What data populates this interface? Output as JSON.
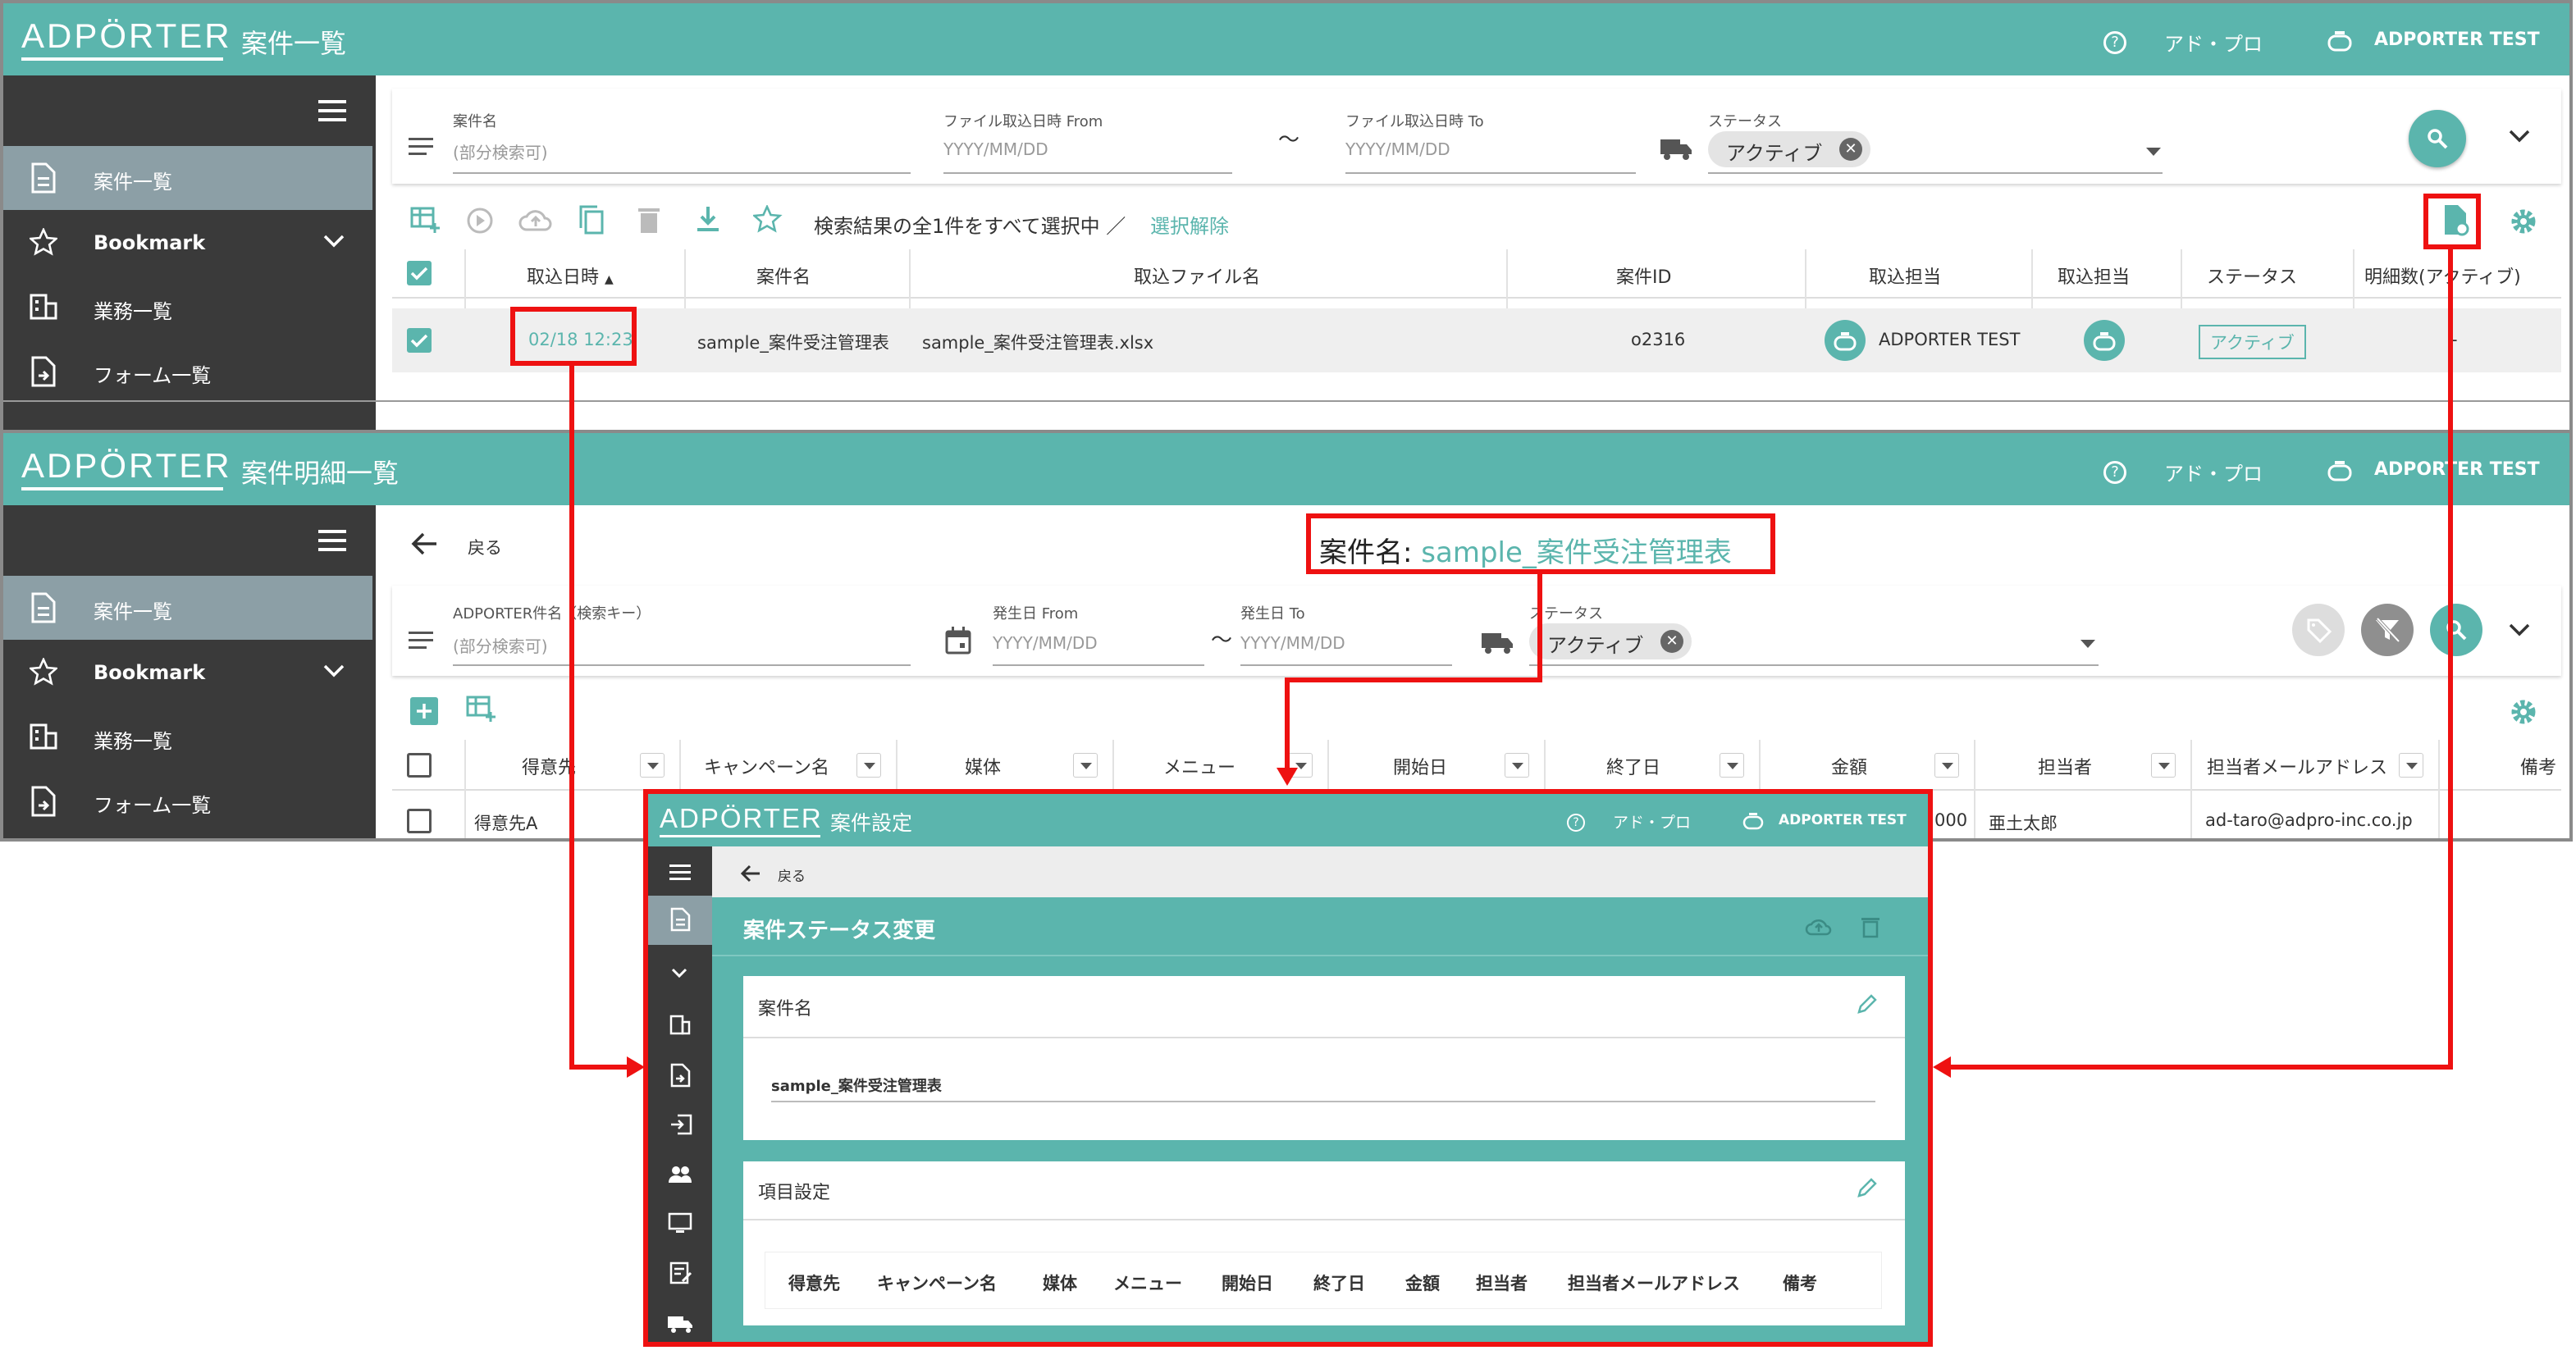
{
  "brand": {
    "logo": "ADPÖRTER"
  },
  "panel1": {
    "title": "案件一覧",
    "header": {
      "help_label": "アド・プロ",
      "user_label": "ADPORTER TEST"
    },
    "sidebar": {
      "items": [
        {
          "label": "案件一覧",
          "icon": "document-icon",
          "active": true
        },
        {
          "label": "Bookmark",
          "icon": "star-icon"
        },
        {
          "label": "業務一覧",
          "icon": "building-icon"
        },
        {
          "label": "フォーム一覧",
          "icon": "form-icon"
        }
      ]
    },
    "filters": {
      "case_name_label": "案件名",
      "case_name_placeholder": "(部分検索可)",
      "file_from_label": "ファイル取込日時 From",
      "file_from_placeholder": "YYYY/MM/DD",
      "tilde": "〜",
      "file_to_label": "ファイル取込日時 To",
      "file_to_placeholder": "YYYY/MM/DD",
      "status_label": "ステータス",
      "status_chip": "アクティブ"
    },
    "toolbar": {
      "selection_text": "検索結果の全1件をすべて選択中 ／",
      "deselect_link": "選択解除"
    },
    "table": {
      "columns": [
        "取込日時",
        "案件名",
        "取込ファイル名",
        "案件ID",
        "取込担当",
        "取込担当",
        "ステータス",
        "明細数(アクティブ)"
      ],
      "sort_indicator": "▲",
      "rows": [
        {
          "date": "02/18 12:23",
          "case_name": "sample_案件受注管理表",
          "file": "sample_案件受注管理表.xlsx",
          "case_id": "o2316",
          "owner": "ADPORTER TEST",
          "status": "アクティブ",
          "count": "-"
        }
      ]
    }
  },
  "panel2": {
    "title": "案件明細一覧",
    "header": {
      "help_label": "アド・プロ",
      "user_label": "ADPORTER TEST"
    },
    "back_label": "戻る",
    "case_name_prefix": "案件名:",
    "case_name_value": "sample_案件受注管理表",
    "sidebar": {
      "items": [
        {
          "label": "案件一覧",
          "icon": "document-icon",
          "active": true
        },
        {
          "label": "Bookmark",
          "icon": "star-icon"
        },
        {
          "label": "業務一覧",
          "icon": "building-icon"
        },
        {
          "label": "フォーム一覧",
          "icon": "form-icon"
        }
      ]
    },
    "filters": {
      "key_label": "ADPORTER件名（検索キー）",
      "key_placeholder": "(部分検索可)",
      "from_label": "発生日 From",
      "from_placeholder": "YYYY/MM/DD",
      "tilde": "〜",
      "to_label": "発生日 To",
      "to_placeholder": "YYYY/MM/DD",
      "status_label": "ステータス",
      "status_chip": "アクティブ"
    },
    "table": {
      "columns": [
        "得意先",
        "キャンペーン名",
        "媒体",
        "メニュー",
        "開始日",
        "終了日",
        "金額",
        "担当者",
        "担当者メールアドレス",
        "備考"
      ],
      "rows": [
        {
          "client": "得意先A",
          "amount_tail": "000",
          "person": "亜土太郎",
          "email": "ad-taro@adpro-inc.co.jp"
        }
      ]
    }
  },
  "panel3": {
    "title": "案件設定",
    "header": {
      "help_label": "アド・プロ",
      "user_label": "ADPORTER TEST"
    },
    "back_label": "戻る",
    "section_title": "案件ステータス変更",
    "case_name_card": {
      "title": "案件名",
      "value": "sample_案件受注管理表"
    },
    "items_card": {
      "title": "項目設定",
      "items": [
        "得意先",
        "キャンペーン名",
        "媒体",
        "メニュー",
        "開始日",
        "終了日",
        "金額",
        "担当者",
        "担当者メールアドレス",
        "備考"
      ]
    }
  },
  "colors": {
    "teal": "#5bb5ad",
    "sidebar": "#3a3a3a",
    "highlight": "#e11111"
  }
}
